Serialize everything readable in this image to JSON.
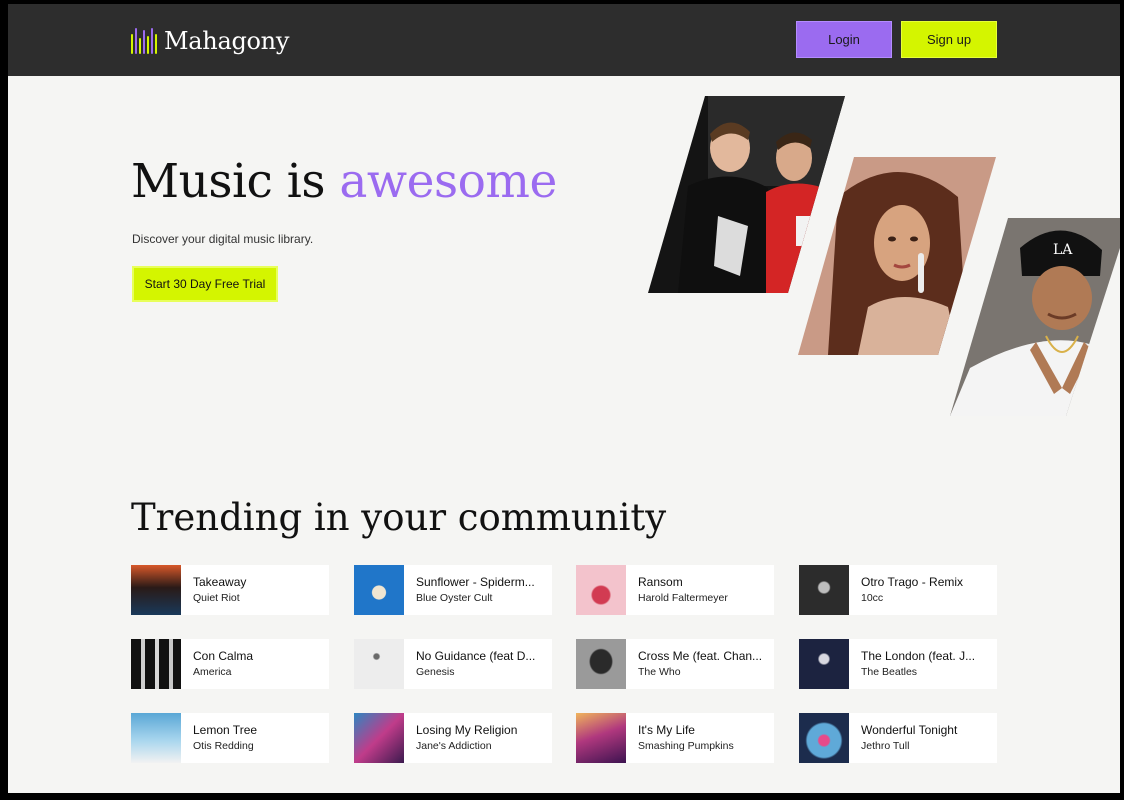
{
  "header": {
    "brand": "Mahagony",
    "login_label": "Login",
    "signup_label": "Sign up"
  },
  "hero": {
    "title_plain": "Music is ",
    "title_accent": "awesome",
    "subtitle": "Discover your digital music library.",
    "cta_label": "Start 30 Day Free Trial"
  },
  "trending": {
    "title": "Trending in your community",
    "tracks": [
      {
        "title": "Takeaway",
        "artist": "Quiet Riot",
        "art_color": "#c8632b"
      },
      {
        "title": "Sunflower - Spiderm...",
        "artist": "Blue Oyster Cult",
        "art_color": "#1f5fa8"
      },
      {
        "title": "Ransom",
        "artist": "Harold Faltermeyer",
        "art_color": "#e7a9b4"
      },
      {
        "title": "Otro Trago - Remix",
        "artist": "10cc",
        "art_color": "#3a3a3a"
      },
      {
        "title": "Con Calma",
        "artist": "America",
        "art_color": "#1a1a1a"
      },
      {
        "title": "No Guidance (feat D...",
        "artist": "Genesis",
        "art_color": "#e9e9e9"
      },
      {
        "title": "Cross Me (feat. Chan...",
        "artist": "The Who",
        "art_color": "#6d6d6d"
      },
      {
        "title": "The London (feat. J...",
        "artist": "The Beatles",
        "art_color": "#1c2340"
      },
      {
        "title": "Lemon Tree",
        "artist": "Otis Redding",
        "art_color": "#8ec7e6"
      },
      {
        "title": "Losing My Religion",
        "artist": "Jane's Addiction",
        "art_color": "#5a2a6e"
      },
      {
        "title": "It's My Life",
        "artist": "Smashing Pumpkins",
        "art_color": "#6e2f86"
      },
      {
        "title": "Wonderful Tonight",
        "artist": "Jethro Tull",
        "art_color": "#2d4d7a"
      }
    ]
  },
  "colors": {
    "accent_purple": "#9b6bf0",
    "accent_lime": "#d4f500",
    "header_bg": "#2d2d2d",
    "page_bg": "#f5f5f3"
  }
}
